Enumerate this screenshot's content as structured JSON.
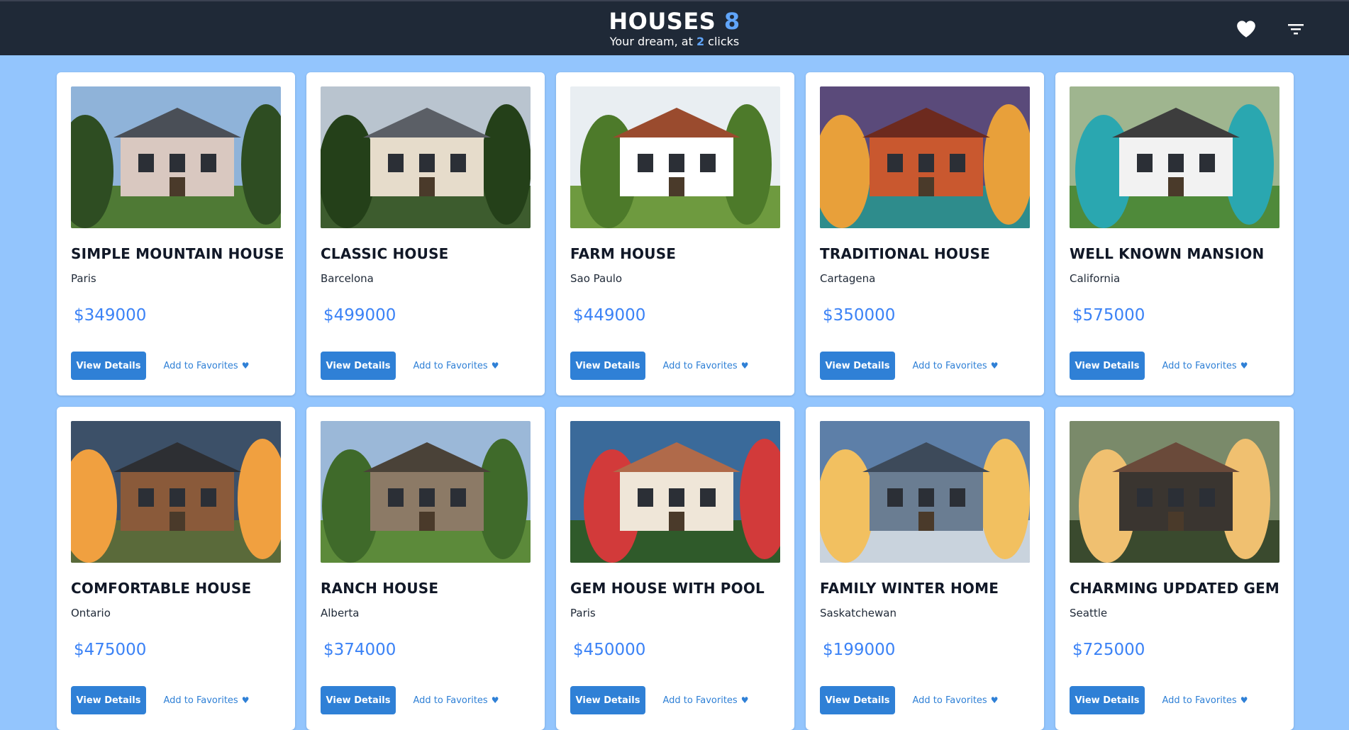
{
  "header": {
    "title": "HOUSES",
    "count": "8",
    "subtitle_prefix": "Your dream, at ",
    "subtitle_count": "2",
    "subtitle_suffix": " clicks",
    "favorites_icon": "heart-icon",
    "filter_icon": "filter-icon"
  },
  "colors": {
    "header_bg": "#1f2937",
    "page_bg": "#93c5fd",
    "accent": "#2f80d6",
    "price": "#3b82f6"
  },
  "houses": [
    {
      "name": "SIMPLE MOUNTAIN HOUSE",
      "city": "Paris",
      "price": "$349000",
      "view_label": "View Details",
      "fav_label": "Add to Favorites"
    },
    {
      "name": "CLASSIC HOUSE",
      "city": "Barcelona",
      "price": "$499000",
      "view_label": "View Details",
      "fav_label": "Add to Favorites"
    },
    {
      "name": "FARM HOUSE",
      "city": "Sao Paulo",
      "price": "$449000",
      "view_label": "View Details",
      "fav_label": "Add to Favorites"
    },
    {
      "name": "TRADITIONAL HOUSE",
      "city": "Cartagena",
      "price": "$350000",
      "view_label": "View Details",
      "fav_label": "Add to Favorites"
    },
    {
      "name": "WELL KNOWN MANSION",
      "city": "California",
      "price": "$575000",
      "view_label": "View Details",
      "fav_label": "Add to Favorites"
    },
    {
      "name": "COMFORTABLE HOUSE",
      "city": "Ontario",
      "price": "$475000",
      "view_label": "View Details",
      "fav_label": "Add to Favorites"
    },
    {
      "name": "RANCH HOUSE",
      "city": "Alberta",
      "price": "$374000",
      "view_label": "View Details",
      "fav_label": "Add to Favorites"
    },
    {
      "name": "GEM HOUSE WITH POOL",
      "city": "Paris",
      "price": "$450000",
      "view_label": "View Details",
      "fav_label": "Add to Favorites"
    },
    {
      "name": "FAMILY WINTER HOME",
      "city": "Saskatchewan",
      "price": "$199000",
      "view_label": "View Details",
      "fav_label": "Add to Favorites"
    },
    {
      "name": "CHARMING UPDATED GEM",
      "city": "Seattle",
      "price": "$725000",
      "view_label": "View Details",
      "fav_label": "Add to Favorites"
    }
  ]
}
